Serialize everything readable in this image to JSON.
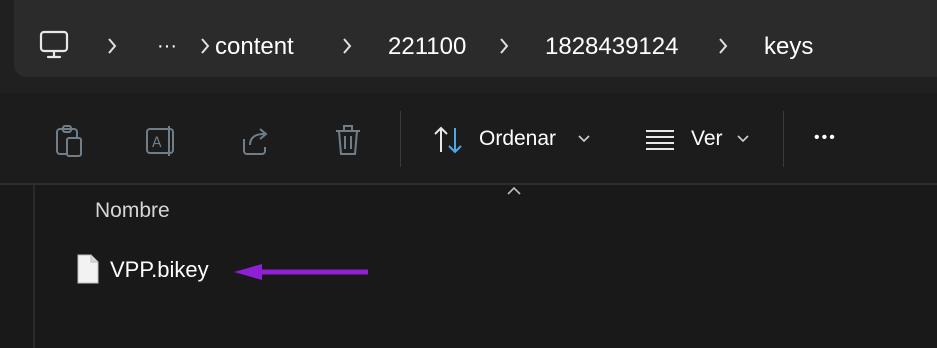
{
  "address_bar": {
    "computer_icon": "monitor-icon",
    "overflow_label": "···",
    "crumbs": [
      "content",
      "221100",
      "1828439124",
      "keys"
    ]
  },
  "toolbar": {
    "sort_label": "Ordenar",
    "view_label": "Ver",
    "more_label": "•••",
    "icons": [
      "paste-icon",
      "rename-icon",
      "share-icon",
      "delete-icon",
      "sort-icon",
      "view-icon"
    ]
  },
  "file_list": {
    "column_name": "Nombre",
    "files": [
      {
        "name": "VPP.bikey",
        "icon": "document-icon"
      }
    ]
  },
  "annotation": {
    "arrow_color": "#8f1fd4"
  },
  "colors": {
    "background": "#191919",
    "address_bar": "#2b2b2b",
    "accent": "#4ea8e8",
    "disabled_icon": "#6f7e89"
  }
}
